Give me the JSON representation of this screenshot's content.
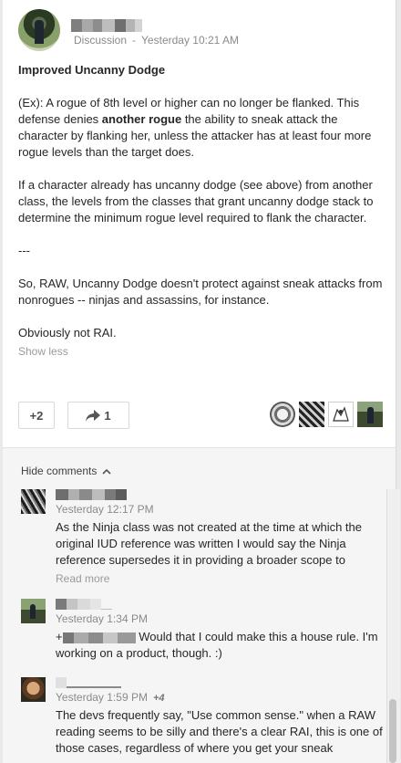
{
  "post": {
    "author_avatar": "profile-photo",
    "meta_category": "Discussion",
    "meta_separator": "-",
    "meta_time": "Yesterday 10:21 AM",
    "title": "Improved Uncanny Dodge",
    "para1_a": "(Ex): A rogue of 8th level or higher can no longer be flanked. This defense denies ",
    "para1_bold": "another rogue",
    "para1_b": " the ability to sneak attack the character by flanking her, unless the attacker has at least four more rogue levels than the target does.",
    "para2": "If a character already has uncanny dodge (see above) from another class, the levels from the classes that grant uncanny dodge stack to determine the minimum rogue level required to flank the character.",
    "para3": "---",
    "para4": "So, RAW, Uncanny Dodge doesn't protect against sneak attacks from nonrogues -- ninjas and assassins, for instance.",
    "para5": "Obviously not RAI.",
    "show_less": "Show less"
  },
  "actions": {
    "plus_label": "+2",
    "share_count": "1",
    "share_icon": "share-arrow-icon"
  },
  "comments_section": {
    "toggle_label": "Hide comments",
    "toggle_icon": "chevron-up-icon"
  },
  "comments": [
    {
      "time": "Yesterday 12:17 PM",
      "text": "As the Ninja class was not created at the time at which the original IUD reference was written I would say the Ninja reference supersedes it in providing a broader scope to",
      "read_more": "Read more"
    },
    {
      "time": "Yesterday 1:34 PM",
      "text_prefix": "+",
      "text": "Would that I could make this a house rule. I'm working on a product, though. :)"
    },
    {
      "time": "Yesterday 1:59 PM",
      "plus": "+4",
      "text": "The devs frequently say, \"Use common sense.\" when a RAW reading seems to be silly and there's a clear RAI, this is one of those cases, regardless of where you get your sneak"
    }
  ],
  "colors": {
    "text": "#262626",
    "meta": "#8a8a8a",
    "comments_bg": "#f5f5f5"
  }
}
